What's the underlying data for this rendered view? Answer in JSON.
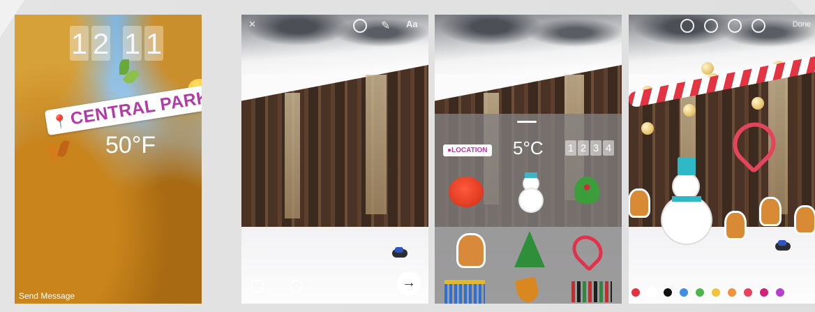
{
  "screens": {
    "s1": {
      "clock_digits": [
        "1",
        "2",
        "1",
        "1"
      ],
      "location_label": "CENTRAL PARK",
      "temperature": "50°F",
      "send_message": "Send Message"
    },
    "s2": {
      "text_tool_label": "Aa",
      "next_glyph": "→"
    },
    "s3": {
      "location_sticker": "LOCATION",
      "temperature_sticker": "5°C",
      "clock_sticker": [
        "1",
        "2",
        "3",
        "4"
      ]
    },
    "s4": {
      "done_label": "Done",
      "palette": [
        "#e8313f",
        "#ffffff",
        "#111111",
        "#3f8ee8",
        "#4cb64c",
        "#f5c33b",
        "#f5913a",
        "#e9425c",
        "#d4207a",
        "#b53fcf"
      ]
    }
  },
  "icons": {
    "location_pin": "📍",
    "close": "✕",
    "next": "→"
  }
}
